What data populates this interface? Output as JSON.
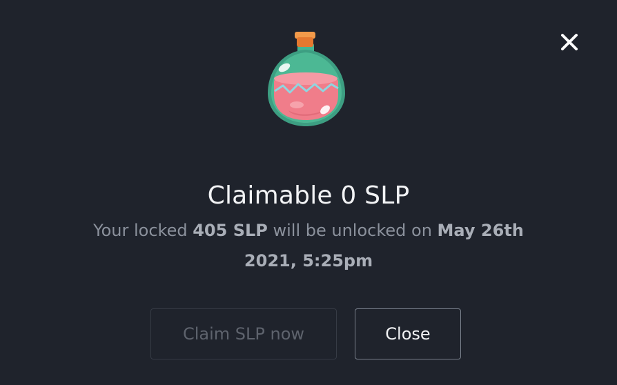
{
  "dialog": {
    "title": "Claimable 0 SLP",
    "message": {
      "prefix": "Your locked ",
      "amount": "405 SLP",
      "middle": " will be unlocked on ",
      "date": "May 26th 2021, 5:25pm"
    },
    "claim_button_label": "Claim SLP now",
    "claim_button_disabled": true,
    "close_button_label": "Close",
    "close_icon": "close-x-icon",
    "illustration_icon": "slp-potion-icon"
  },
  "colors": {
    "background": "#1f232c",
    "title_text": "#f2f3f5",
    "message_text": "#8b919c",
    "potion_green": "#3fa88a",
    "potion_pink": "#f07d8a",
    "cork_orange": "#e8843c"
  }
}
